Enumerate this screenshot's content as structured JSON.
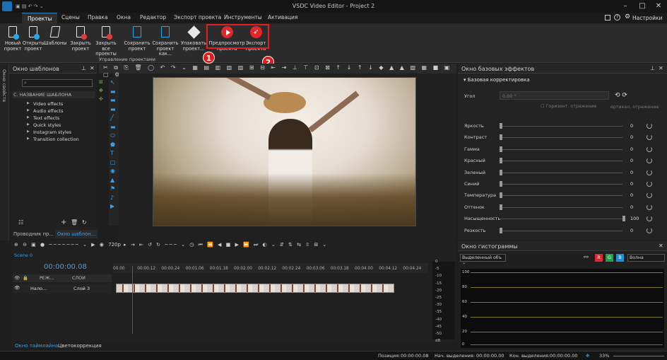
{
  "window": {
    "title": "VSDC Video Editor - Project 2",
    "settings_label": "Настройки"
  },
  "menu": [
    "Проекты",
    "Сцены",
    "Правка",
    "Окна",
    "Редактор",
    "Экспорт проекта",
    "Инструменты",
    "Активация"
  ],
  "ribbon": {
    "buttons": [
      {
        "l1": "Новый",
        "l2": "проект",
        "icon": "new-project-icon"
      },
      {
        "l1": "Открыть",
        "l2": "проект",
        "icon": "open-project-icon"
      },
      {
        "l1": "Шаблоны",
        "l2": "",
        "icon": "templates-icon"
      },
      {
        "l1": "Закрыть",
        "l2": "проект",
        "icon": "close-project-icon"
      },
      {
        "l1": "Закрыть все",
        "l2": "проекты",
        "icon": "close-all-icon"
      },
      {
        "l1": "Сохранить",
        "l2": "проект",
        "icon": "save-icon"
      },
      {
        "l1": "Сохранить",
        "l2": "проект как...",
        "icon": "save-as-icon"
      },
      {
        "l1": "Упаковать",
        "l2": "проект...",
        "icon": "pack-icon"
      },
      {
        "l1": "Предпросмотр",
        "l2": "проекта",
        "icon": "preview-play-icon"
      },
      {
        "l1": "Экспорт",
        "l2": "проекта",
        "icon": "export-rocket-icon"
      }
    ],
    "group_label": "Управление проектами",
    "callouts": [
      "1",
      "2"
    ]
  },
  "templates_panel": {
    "title": "Окно шаблонов",
    "vertical_tab": "Окно свойств",
    "search_placeholder": "",
    "column": "НАЗВАНИЕ ШАБЛОНА",
    "items": [
      "Video effects",
      "Audio effects",
      "Text effects",
      "Quick styles",
      "Instagram styles",
      "Transition collection"
    ],
    "tabs": [
      "Проводник пр...",
      "Окно шаблон..."
    ]
  },
  "preview_toolbar": {
    "resolution": "720p"
  },
  "effects_panel": {
    "title": "Окно базовых эффектов",
    "section": "Базовая корректировка",
    "angle_label": "Угол",
    "angle_value": "0.00 °",
    "hflip": "Горизонт. отражение",
    "vflip": "ертикал. отражение",
    "rows": [
      {
        "label": "Яркость",
        "value": "0",
        "pos": 0.0
      },
      {
        "label": "Контраст",
        "value": "0",
        "pos": 0.0
      },
      {
        "label": "Гамма",
        "value": "0",
        "pos": 0.0
      },
      {
        "label": "Красный",
        "value": "0",
        "pos": 0.0
      },
      {
        "label": "Зеленый",
        "value": "0",
        "pos": 0.0
      },
      {
        "label": "Синий",
        "value": "0",
        "pos": 0.0
      },
      {
        "label": "Температура",
        "value": "0",
        "pos": 0.0
      },
      {
        "label": "Оттенок",
        "value": "0",
        "pos": 0.0
      },
      {
        "label": "Насыщенность",
        "value": "100",
        "pos": 1.0
      },
      {
        "label": "Резкость",
        "value": "0",
        "pos": 0.0
      }
    ]
  },
  "histogram": {
    "title": "Окно гистограммы",
    "source": "Выделенный объ",
    "channels": [
      "R",
      "G",
      "B"
    ],
    "mode": "Волна",
    "scale": [
      "100",
      "80",
      "60",
      "40",
      "20",
      "0"
    ]
  },
  "timeline": {
    "scene_tab": "Scene 0",
    "time": "00:00:00.08",
    "mode_label": "РЕЖ...",
    "layers_label": "СЛОИ",
    "track_blend": "Нало...",
    "track_name": "Слой 3",
    "ticks": [
      "00.00",
      "00:00.12",
      "00:00.24",
      "00:01.06",
      "00:01.18",
      "00:02.00",
      "00:02.12",
      "00:02.24",
      "00:03.06",
      "00:03.18",
      "00:04.00",
      "00:04.12",
      "00:04.24"
    ],
    "db_scale": [
      "0",
      "-5",
      "-10",
      "-15",
      "-20",
      "-25",
      "-30",
      "-35",
      "-40",
      "-45",
      "-50",
      "dB"
    ],
    "tabs": [
      "Окно таймлайна",
      "Цветокоррекция"
    ]
  },
  "status": {
    "position_label": "Позиция:",
    "position": "00:00:00.08",
    "sel_start_label": "Нач. выделения:",
    "sel_start": "00:00:00.00",
    "sel_end_label": "Кон. выделения:",
    "sel_end": "00:00:00.00",
    "zoom": "33%"
  }
}
